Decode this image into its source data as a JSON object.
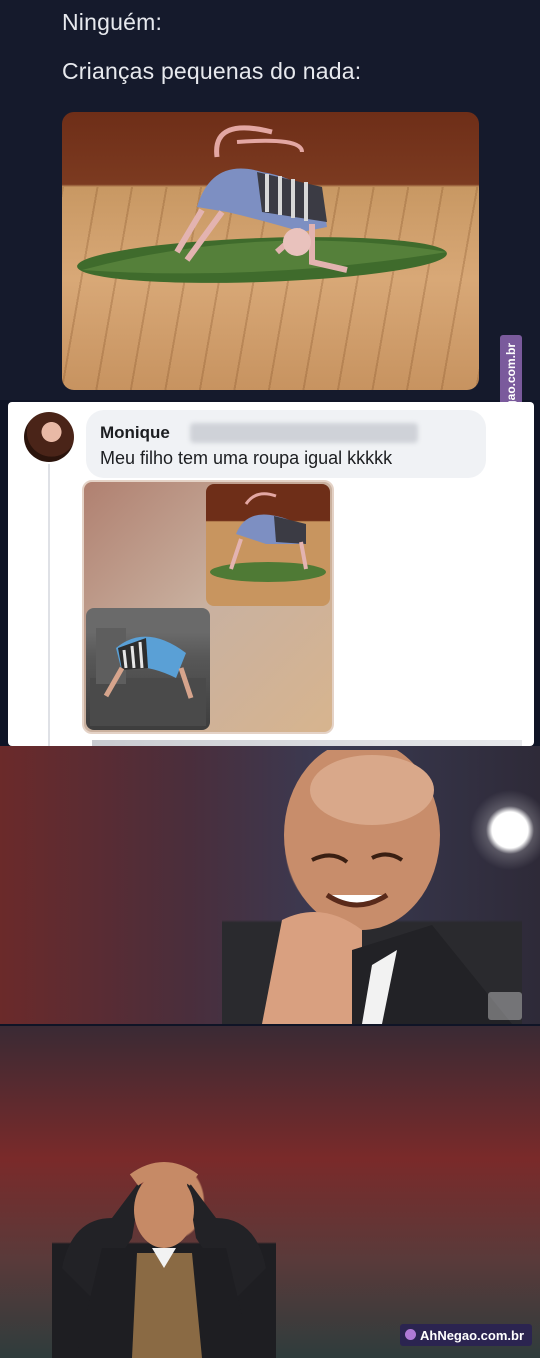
{
  "tweet": {
    "line1": "Ninguém:",
    "line2": "Crianças pequenas do nada:"
  },
  "watermark": {
    "side": "AhNegao.com.br",
    "bottom": "AhNegao.com.br"
  },
  "comment": {
    "author": "Monique",
    "text": "Meu filho tem uma roupa igual kkkkk"
  }
}
